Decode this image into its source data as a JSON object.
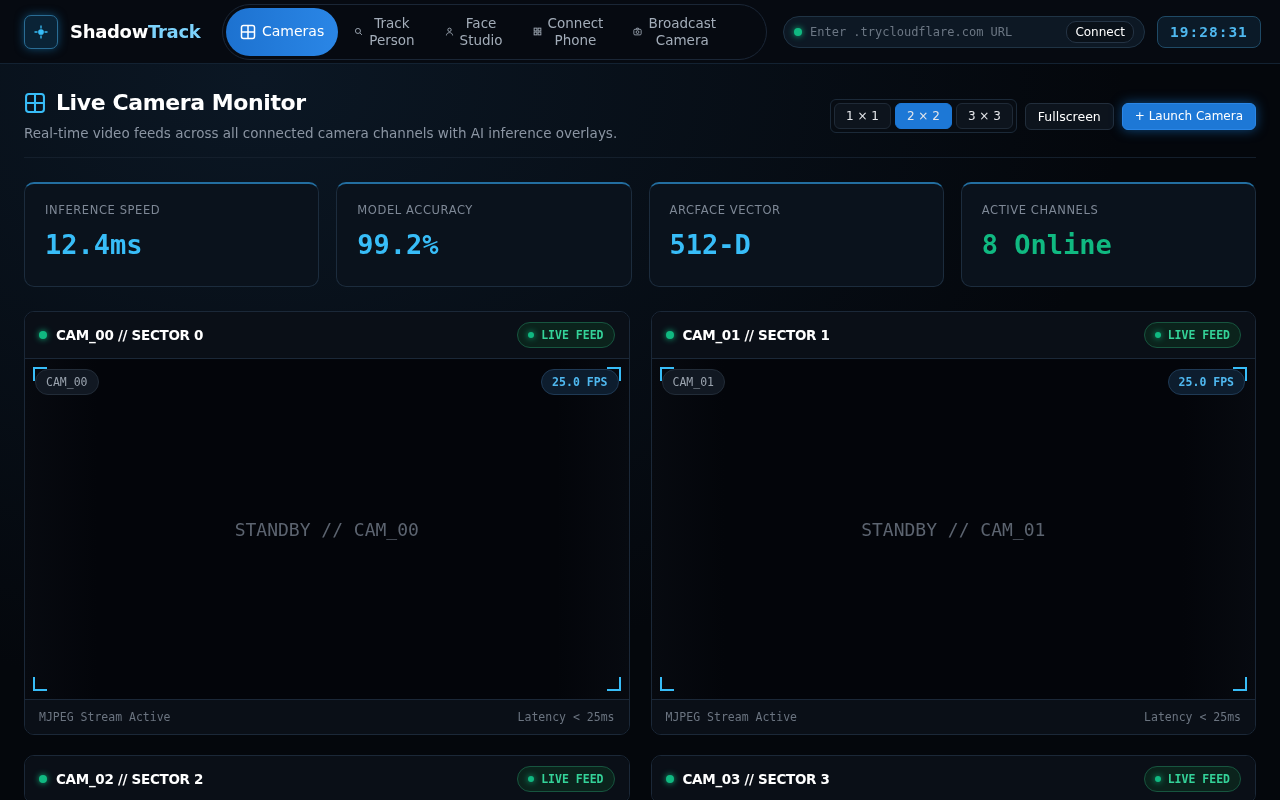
{
  "brand": {
    "name_main": "Shadow",
    "name_accent": "Track"
  },
  "nav": [
    {
      "label": "Cameras",
      "selected": true
    },
    {
      "label": "Track Person",
      "selected": false
    },
    {
      "label": "Face Studio",
      "selected": false
    },
    {
      "label": "Connect Phone",
      "selected": false
    },
    {
      "label": "Broadcast Camera",
      "selected": false
    }
  ],
  "url_field": {
    "placeholder": "Enter .trycloudflare.com URL",
    "button": "Connect"
  },
  "clock": "19:28:31",
  "page": {
    "title": "Live Camera Monitor",
    "subtitle": "Real-time video feeds across all connected camera channels with AI inference overlays."
  },
  "grid_options": [
    {
      "label": "1 × 1",
      "selected": false
    },
    {
      "label": "2 × 2",
      "selected": true
    },
    {
      "label": "3 × 3",
      "selected": false
    }
  ],
  "actions": [
    {
      "label": "Fullscreen",
      "kind": "plain"
    },
    {
      "label": "+ Launch Camera",
      "kind": "primary"
    }
  ],
  "stats": [
    {
      "label": "INFERENCE SPEED",
      "value": "12.4ms",
      "color": "#38bdf8"
    },
    {
      "label": "MODEL ACCURACY",
      "value": "99.2%",
      "color": "#38bdf8"
    },
    {
      "label": "ARCFACE VECTOR",
      "value": "512-D",
      "color": "#38bdf8"
    },
    {
      "label": "ACTIVE CHANNELS",
      "value": "8 Online",
      "color": "#10b981"
    }
  ],
  "cameras": [
    {
      "title": "CAM_00 // SECTOR 0",
      "badge": "LIVE FEED",
      "tag": "CAM_00",
      "fps": "25.0 FPS",
      "standby": "STANDBY // CAM_00",
      "footer_left": "MJPEG Stream Active",
      "footer_right": "Latency < 25ms"
    },
    {
      "title": "CAM_01 // SECTOR 1",
      "badge": "LIVE FEED",
      "tag": "CAM_01",
      "fps": "25.0 FPS",
      "standby": "STANDBY // CAM_01",
      "footer_left": "MJPEG Stream Active",
      "footer_right": "Latency < 25ms"
    },
    {
      "title": "CAM_02 // SECTOR 2",
      "badge": "LIVE FEED"
    },
    {
      "title": "CAM_03 // SECTOR 3",
      "badge": "LIVE FEED"
    }
  ]
}
